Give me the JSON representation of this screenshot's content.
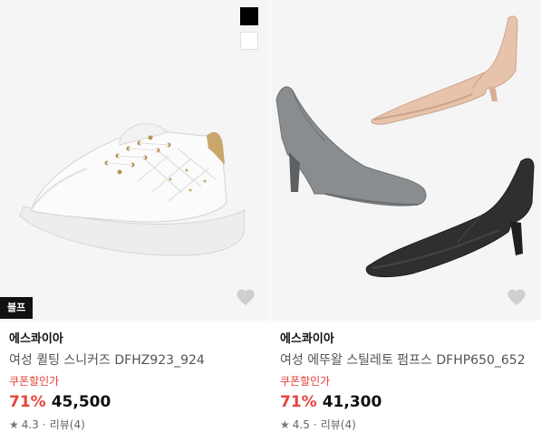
{
  "products": [
    {
      "brand": "에스콰이아",
      "name": "여성 퀼팅 스니커즈 DFHZ923_924",
      "coupon": "쿠폰할인가",
      "discount": "71%",
      "price": "45,500",
      "rating": "4.3",
      "separator": "·",
      "review": "리뷰(4)",
      "badge": "블프",
      "swatches": [
        "#000000",
        "#ffffff"
      ],
      "icon": "heart-icon"
    },
    {
      "brand": "에스콰이아",
      "name": "여성 에뚜왈 스틸레토 펌프스 DFHP650_652",
      "coupon": "쿠폰할인가",
      "discount": "71%",
      "price": "41,300",
      "rating": "4.5",
      "separator": "·",
      "review": "리뷰(4)",
      "icon": "heart-icon"
    }
  ],
  "colors": {
    "accent": "#e5443a",
    "thumb_bg": "#f5f5f5",
    "badge_bg": "#111111"
  }
}
